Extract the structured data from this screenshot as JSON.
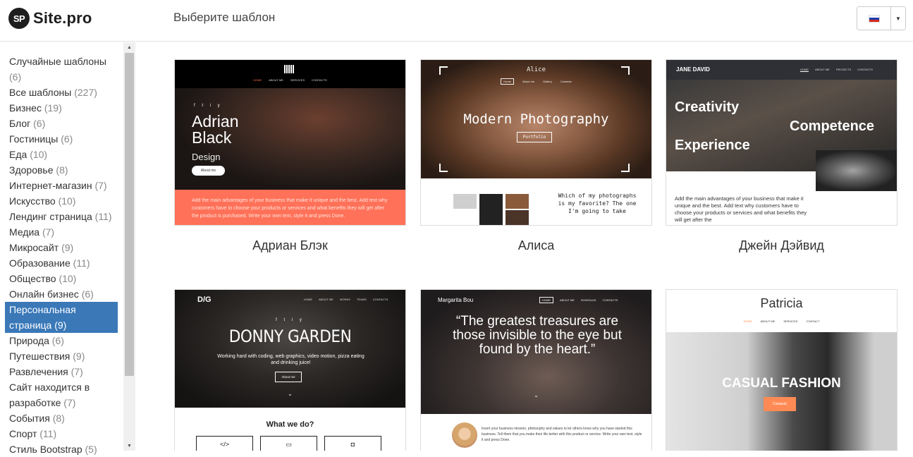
{
  "header": {
    "logo_badge": "SP",
    "logo_text": "Site.pro",
    "page_heading": "Выберите шаблон",
    "language_flag": "russia-flag-icon",
    "language_caret": "▼"
  },
  "sidebar": {
    "categories": [
      {
        "label": "Случайные шаблоны",
        "count": "(6)"
      },
      {
        "label": "Все шаблоны",
        "count": "(227)"
      },
      {
        "label": "Бизнес",
        "count": "(19)"
      },
      {
        "label": "Блог",
        "count": "(6)"
      },
      {
        "label": "Гостиницы",
        "count": "(6)"
      },
      {
        "label": "Еда",
        "count": "(10)"
      },
      {
        "label": "Здоровье",
        "count": "(8)"
      },
      {
        "label": "Интернет-магазин",
        "count": "(7)"
      },
      {
        "label": "Искусство",
        "count": "(10)"
      },
      {
        "label": "Лендинг страница",
        "count": "(11)"
      },
      {
        "label": "Медиа",
        "count": "(7)"
      },
      {
        "label": "Микросайт",
        "count": "(9)"
      },
      {
        "label": "Образование",
        "count": "(11)"
      },
      {
        "label": "Общество",
        "count": "(10)"
      },
      {
        "label": "Онлайн бизнес",
        "count": "(6)"
      },
      {
        "label": "Персональная страница",
        "count": "(9)"
      },
      {
        "label": "Природа",
        "count": "(6)"
      },
      {
        "label": "Путешествия",
        "count": "(9)"
      },
      {
        "label": "Развлечения",
        "count": "(7)"
      },
      {
        "label": "Сайт находится в разработке",
        "count": "(7)"
      },
      {
        "label": "События",
        "count": "(8)"
      },
      {
        "label": "Спорт",
        "count": "(11)"
      },
      {
        "label": "Стиль Bootstrap",
        "count": "(5)"
      }
    ],
    "active_index": 15
  },
  "templates": [
    {
      "title": "Адриан Блэк",
      "nav": [
        "HOME",
        "ABOUT ME",
        "SERVICES",
        "CONTACTS"
      ],
      "social": "f t i y",
      "heading": "Adrian Black",
      "sub": "Design",
      "button": "About me",
      "footer": "Add the main advantages of your business that make it unique and the best. Add text why customers have to choose your products or services and what benefits they will get after the product is purchased. Write your own text, style it and press Done."
    },
    {
      "title": "Алиса",
      "name": "Alice",
      "nav": [
        "Home",
        "About me",
        "Gallery",
        "Contacts"
      ],
      "heading": "Modern Photography",
      "button": "Portfolio",
      "text": "Which of my photographs is my favorite? The one I'm going to take"
    },
    {
      "title": "Джейн Дэйвид",
      "brand": "JANE DAVID",
      "nav": [
        "HOME",
        "ABOUT ME",
        "PROJECTS",
        "CONTACTS"
      ],
      "words": [
        "Creativity",
        "Competence",
        "Experience"
      ],
      "footer": "Add the main advantages of your business that make it unique and the best. Add text why customers have to choose your products or services and what benefits they will get after the"
    },
    {
      "title": "",
      "logo": "D/G",
      "nav": [
        "HOME",
        "ABOUT ME",
        "WORKS",
        "TEAMS",
        "CONTACTS"
      ],
      "social": "f t i y",
      "heading": "DONNY GARDEN",
      "sub": "Working hard with coding, web graphics, video motion, pizza eating and drinking juice!",
      "button": "About me",
      "chevron": "⌄",
      "what": "What we do?",
      "icons": [
        "</>",
        "▭",
        "◘"
      ]
    },
    {
      "title": "",
      "brand": "Margarita Bou",
      "nav": [
        "HOME",
        "ABOUT ME",
        "SCHEDULE",
        "CONTACTS"
      ],
      "quote": "“The greatest treasures are those invisible to the eye but found by the heart.”",
      "chevron": "⌄",
      "text": "Insert your business mission, philosophy and values to let others know why you have started this business. Tell them that you make their life better with this product or service. Write your own text, style it and press Done."
    },
    {
      "title": "",
      "name": "Patricia",
      "nav": [
        "HOME",
        "ABOUT ME",
        "SERVICES",
        "CONTACT"
      ],
      "heading": "CASUAL FASHION",
      "button": "Contacts"
    }
  ],
  "colors": {
    "active_category": "#3a78b8",
    "adrian_footer": "#ff7158",
    "patricia_button": "#ff8a55"
  }
}
